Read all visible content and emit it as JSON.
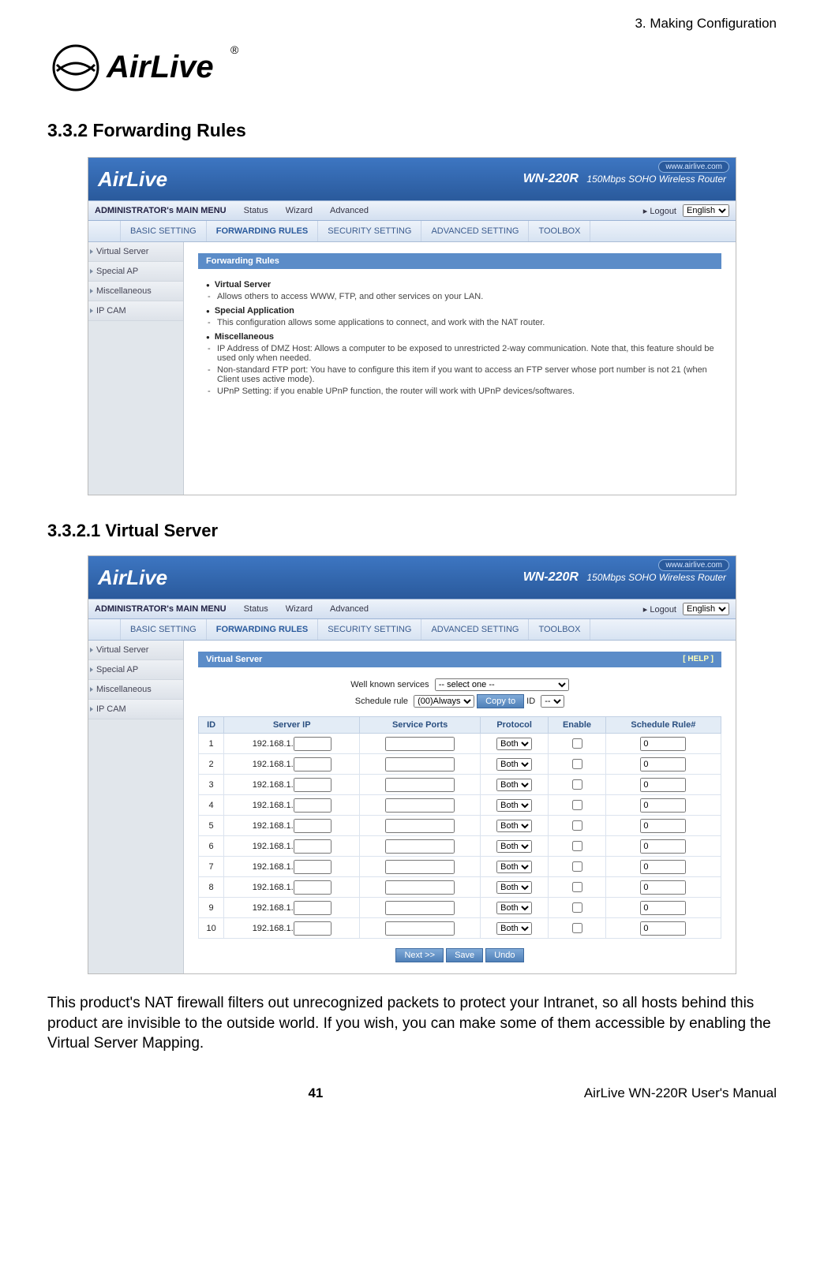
{
  "chapter": "3.  Making  Configuration",
  "logo_text": "AirLive",
  "heading_332": "3.3.2 Forwarding Rules",
  "heading_3321": "3.3.2.1  Virtual Server",
  "shot_common": {
    "brand": "AirLive",
    "model": "WN-220R",
    "model_sub": "150Mbps SOHO Wireless Router",
    "url_pill": "www.airlive.com",
    "admin_menu": "ADMINISTRATOR's MAIN MENU",
    "menu1": [
      "Status",
      "Wizard",
      "Advanced"
    ],
    "logout": "Logout",
    "lang_selected": "English",
    "menu2": [
      "BASIC SETTING",
      "FORWARDING RULES",
      "SECURITY SETTING",
      "ADVANCED SETTING",
      "TOOLBOX"
    ],
    "sidebar": [
      "Virtual Server",
      "Special AP",
      "Miscellaneous",
      "IP CAM"
    ]
  },
  "shot1": {
    "panel_title": "Forwarding Rules",
    "items": [
      {
        "head": "Virtual Server",
        "subs": [
          "Allows others to access WWW, FTP, and other services on your LAN."
        ]
      },
      {
        "head": "Special Application",
        "subs": [
          "This configuration allows some applications to connect, and work with the NAT router."
        ]
      },
      {
        "head": "Miscellaneous",
        "subs": [
          "IP Address of DMZ Host: Allows a computer to be exposed to unrestricted 2-way communication. Note that, this feature should be used only when needed.",
          "Non-standard FTP port: You have to configure this item if you want to access an FTP server whose port number is not 21 (when Client uses active mode).",
          "UPnP Setting: if you enable UPnP function, the router will work with UPnP devices/softwares."
        ]
      }
    ]
  },
  "shot2": {
    "panel_title": "Virtual Server",
    "help": "[ HELP ]",
    "well_known_label": "Well known services",
    "well_known_selected": "-- select one --",
    "schedule_label": "Schedule rule",
    "schedule_selected": "(00)Always",
    "copy_to": "Copy to",
    "id_label": "ID",
    "id_selected": "--",
    "table_headers": [
      "ID",
      "Server IP",
      "Service Ports",
      "Protocol",
      "Enable",
      "Schedule Rule#"
    ],
    "ip_prefix": "192.168.1.",
    "protocol_selected": "Both",
    "schedule_default": "0",
    "row_ids": [
      "1",
      "2",
      "3",
      "4",
      "5",
      "6",
      "7",
      "8",
      "9",
      "10"
    ],
    "buttons": [
      "Next >>",
      "Save",
      "Undo"
    ]
  },
  "body_text": "This product's NAT firewall filters out unrecognized packets to protect your Intranet, so all hosts behind this product are invisible to the outside world. If you wish, you can make some of them accessible by enabling the Virtual Server Mapping.",
  "footer_page": "41",
  "footer_right": "AirLive  WN-220R  User's  Manual"
}
